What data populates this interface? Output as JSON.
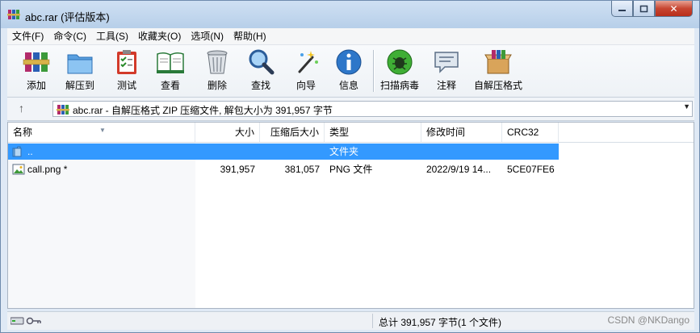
{
  "window": {
    "title": "abc.rar (评估版本)",
    "controls": {
      "minimize": "▭",
      "maximize": "▢",
      "close": "✕"
    }
  },
  "menu": [
    "文件(F)",
    "命令(C)",
    "工具(S)",
    "收藏夹(O)",
    "选项(N)",
    "帮助(H)"
  ],
  "toolbar": {
    "add": "添加",
    "extract_to": "解压到",
    "test": "测试",
    "view": "查看",
    "delete": "删除",
    "find": "查找",
    "wizard": "向导",
    "info": "信息",
    "virus_scan": "扫描病毒",
    "comment": "注释",
    "sfx": "自解压格式"
  },
  "address": {
    "up": "↑",
    "text": "abc.rar - 自解压格式 ZIP 压缩文件, 解包大小为 391,957 字节",
    "dropdown": "▼"
  },
  "columns": {
    "name": "名称",
    "size": "大小",
    "packed": "压缩后大小",
    "type": "类型",
    "modified": "修改时间",
    "crc": "CRC32"
  },
  "rows": [
    {
      "name": "..",
      "size": "",
      "packed": "",
      "type": "文件夹",
      "modified": "",
      "crc": "",
      "icon": "folder-icon"
    },
    {
      "name": "call.png *",
      "size": "391,957",
      "packed": "381,057",
      "type": "PNG 文件",
      "modified": "2022/9/19 14...",
      "crc": "5CE07FE6",
      "icon": "image-file-icon"
    }
  ],
  "status": {
    "summary": "总计 391,957 字节(1 个文件)"
  },
  "watermark": "CSDN @NKDango",
  "colors": {
    "selection": "#3399ff",
    "close_button": "#c74632",
    "title_bar": "#cfe0f3"
  }
}
